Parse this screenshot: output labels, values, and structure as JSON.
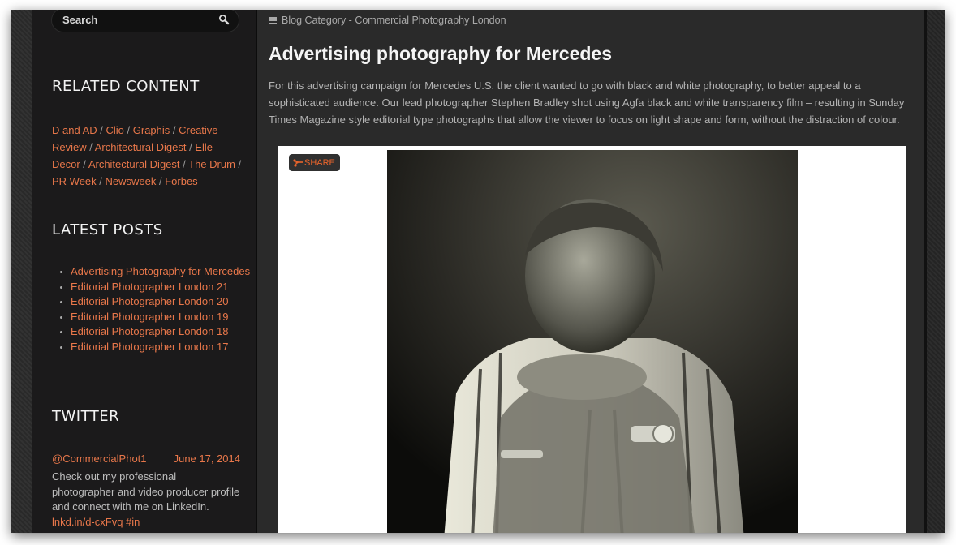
{
  "sidebar": {
    "search": {
      "placeholder": "Search",
      "icon": "search-icon"
    },
    "related": {
      "title": "RELATED CONTENT",
      "links": [
        "D and AD",
        "Clio",
        "Graphis",
        "Creative Review",
        "Architectural Digest",
        "Elle Decor",
        "Architectural Digest",
        "The Drum",
        "PR Week",
        "Newsweek",
        "Forbes"
      ]
    },
    "latest": {
      "title": "LATEST POSTS",
      "items": [
        "Advertising Photography for Mercedes",
        "Editorial Photographer London 21",
        "Editorial Photographer London 20",
        "Editorial Photographer London 19",
        "Editorial Photographer London 18",
        "Editorial Photographer London 17"
      ]
    },
    "twitter": {
      "title": "TWITTER",
      "handle": "@CommercialPhot1",
      "date": "June 17, 2014",
      "text": "Check out my professional photographer and video producer profile and connect with me on LinkedIn.",
      "link": "lnkd.in/d-cxFvq",
      "hashtag": "#in"
    }
  },
  "main": {
    "breadcrumb": "Blog Category - Commercial Photography London",
    "title": "Advertising photography for Mercedes",
    "lede": "For this advertising campaign for Mercedes U.S. the client wanted to go with black and white photography, to better appeal to a sophisticated audience. Our lead photographer Stephen Bradley shot using Agfa black and white transparency film – resulting in Sunday Times Magazine style editorial type photographs that allow the viewer to focus on light shape and form, without the distraction of colour.",
    "share_label": "SHARE",
    "photo_alt": "Black and white portrait of a man resting chin on clasped hands"
  },
  "colors": {
    "link": "#e8774a",
    "share": "#e8642c"
  }
}
